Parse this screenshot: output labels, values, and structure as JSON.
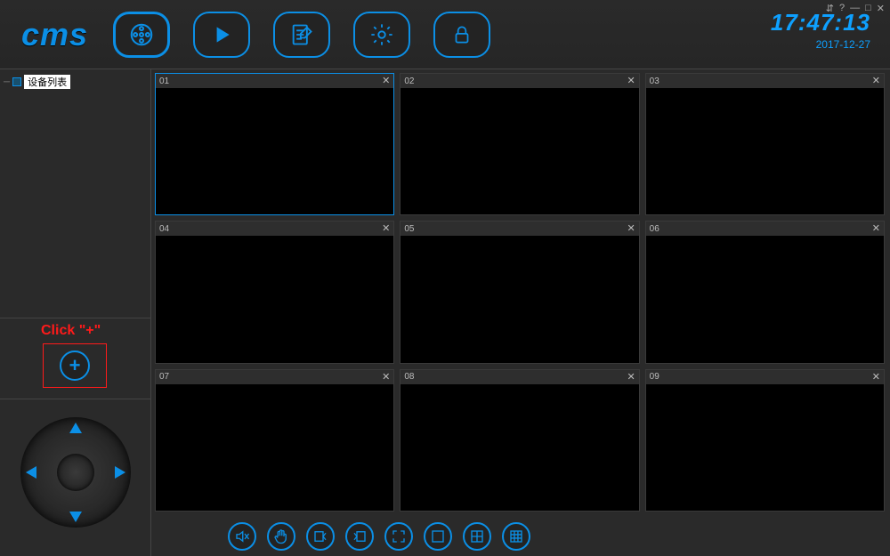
{
  "app": {
    "logo": "cms"
  },
  "clock": {
    "time": "17:47:13",
    "date": "2017-12-27"
  },
  "window_controls": {
    "switch": "⇵",
    "help": "?",
    "minimize": "—",
    "maximize": "□",
    "close": "✕"
  },
  "sidebar": {
    "tree": {
      "root_label": "设备列表"
    },
    "add": {
      "hint": "Click \"+\"",
      "glyph": "+"
    }
  },
  "topbar": {
    "buttons": [
      {
        "name": "liveview",
        "active": true
      },
      {
        "name": "playback",
        "active": false
      },
      {
        "name": "log",
        "active": false
      },
      {
        "name": "settings",
        "active": false
      },
      {
        "name": "lock",
        "active": false
      }
    ]
  },
  "grid": {
    "cells": [
      {
        "label": "01",
        "selected": true
      },
      {
        "label": "02",
        "selected": false
      },
      {
        "label": "03",
        "selected": false
      },
      {
        "label": "04",
        "selected": false
      },
      {
        "label": "05",
        "selected": false
      },
      {
        "label": "06",
        "selected": false
      },
      {
        "label": "07",
        "selected": false
      },
      {
        "label": "08",
        "selected": false
      },
      {
        "label": "09",
        "selected": false
      }
    ],
    "close_glyph": "✕"
  },
  "bottombar": {
    "buttons": [
      {
        "name": "mute"
      },
      {
        "name": "hand"
      },
      {
        "name": "page-prev"
      },
      {
        "name": "page-next"
      },
      {
        "name": "fullscreen"
      },
      {
        "name": "layout-1"
      },
      {
        "name": "layout-4"
      },
      {
        "name": "layout-9"
      }
    ]
  }
}
